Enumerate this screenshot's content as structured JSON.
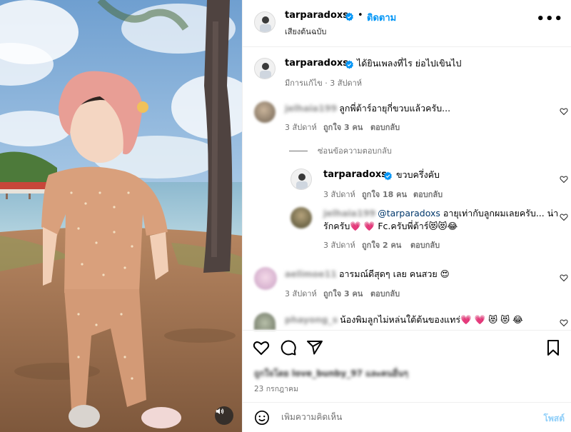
{
  "header": {
    "username": "tarparadoxs",
    "separator": "•",
    "follow_label": "ติดตาม",
    "audio_label": "เสียงต้นฉบับ",
    "more_icon": "more-horizontal-icon"
  },
  "caption": {
    "username": "tarparadoxs",
    "text": "ได้ยินเพลงที่ไร ย่อไปเขินไป",
    "meta": "มีการแก้ไข · 3 สัปดาห์"
  },
  "comments": [
    {
      "username": "jelhaia199",
      "text": "ลูกพี่ต้าร์อายุกี่ขวบแล้วครับ...",
      "time": "3 สัปดาห์",
      "likes": "ถูกใจ 3 คน",
      "reply": "ตอบกลับ"
    },
    {
      "username": "tarparadoxs",
      "text": "ขวบครึ่งคับ",
      "time": "3 สัปดาห์",
      "likes": "ถูกใจ 18 คน",
      "reply": "ตอบกลับ"
    },
    {
      "username": "jelhaia199",
      "mention": "@tarparadoxs",
      "text_line1": "อายุเท่ากับลูกผมเลยครับ... น่า",
      "text_line2": "รักครับ💗 💗 Fc.ครับพี่ต้าร์😻😻😂",
      "time": "3 สัปดาห์",
      "likes": "ถูกใจ 2 คน",
      "reply": "ตอบกลับ"
    },
    {
      "username": "aelimoe11",
      "text": "อารมณ์ดีสุดๆ เลย คนสวย 😍",
      "time": "3 สัปดาห์",
      "likes": "ถูกใจ 3 คน",
      "reply": "ตอบกลับ"
    },
    {
      "username": "phayong_s",
      "text": "น้องพิมลูกไม่หล่นใต้ต้นของแทร่💗 💗 😻 😻 😂"
    }
  ],
  "hide_replies_label": "ซ่อนข้อความตอบกลับ",
  "actions": {
    "like_icon": "heart-icon",
    "comment_icon": "comment-icon",
    "share_icon": "share-icon",
    "save_icon": "bookmark-icon"
  },
  "likes_summary": "ถูกใจโดย love_bunby_97 และคนอื่นๆ",
  "date": "23 กรกฎาคม",
  "comment_box": {
    "placeholder": "เพิ่มความคิดเห็น",
    "post_label": "โพสต์"
  },
  "colors": {
    "link_blue": "#0095f6",
    "post_disabled": "#8fcff9",
    "mention": "#00376b",
    "meta_gray": "#737373"
  }
}
